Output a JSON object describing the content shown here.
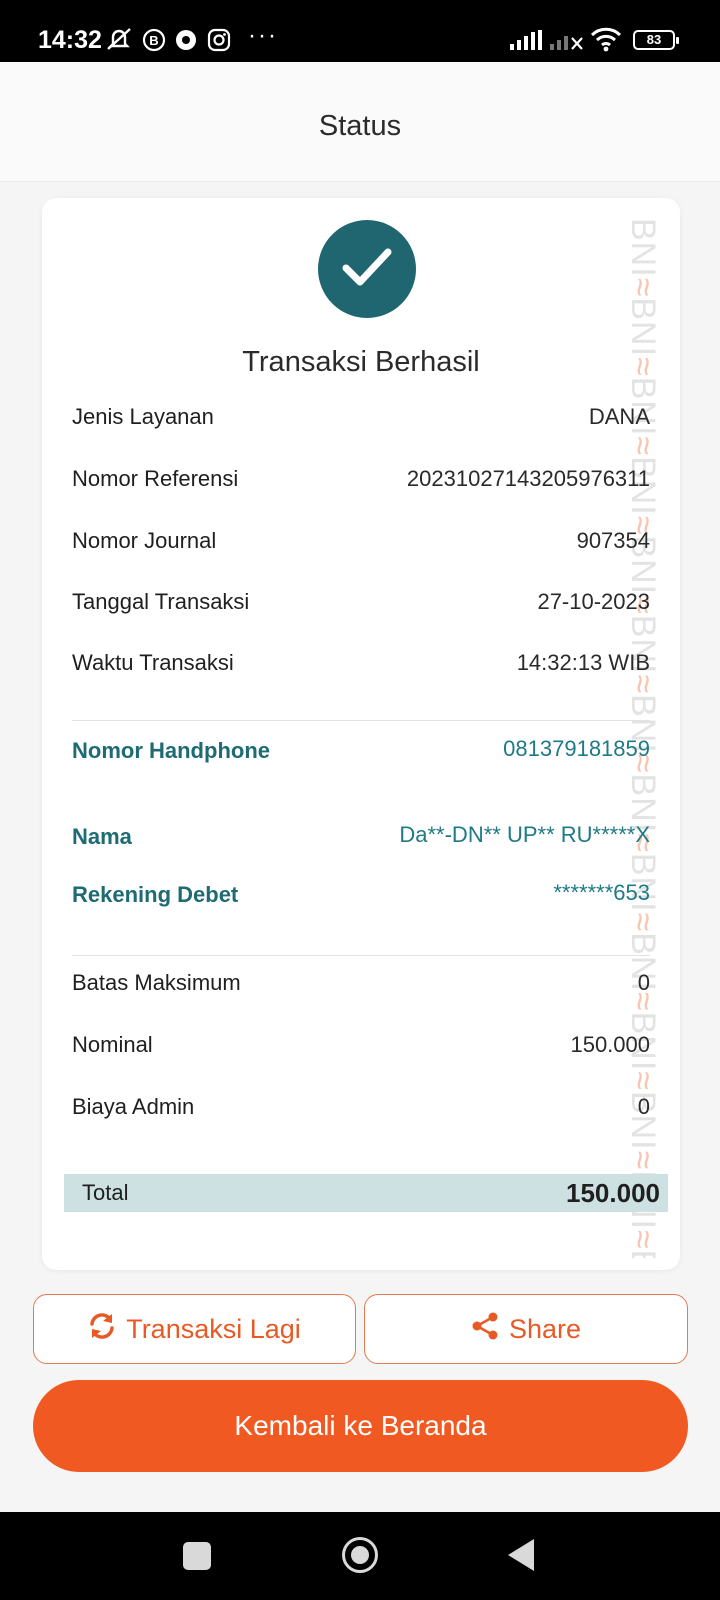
{
  "status_bar": {
    "time": "14:32",
    "battery": "83"
  },
  "header": {
    "title": "Status"
  },
  "watermark": {
    "brand": "BNI"
  },
  "receipt": {
    "title": "Transaksi Berhasil",
    "details": [
      {
        "label": "Jenis Layanan",
        "value": "DANA"
      },
      {
        "label": "Nomor Referensi",
        "value": "20231027143205976311"
      },
      {
        "label": "Nomor Journal",
        "value": "907354"
      },
      {
        "label": "Tanggal Transaksi",
        "value": "27-10-2023"
      },
      {
        "label": "Waktu Transaksi",
        "value": "14:32:13 WIB"
      }
    ],
    "account": [
      {
        "label": "Nomor Handphone",
        "value": "081379181859"
      },
      {
        "label": "Nama",
        "value": "Da**-DN** UP** RU*****X"
      },
      {
        "label": "Rekening Debet",
        "value": "*******653"
      }
    ],
    "amounts": [
      {
        "label": "Batas Maksimum",
        "value": "0"
      },
      {
        "label": "Nominal",
        "value": "150.000"
      },
      {
        "label": "Biaya Admin",
        "value": "0"
      }
    ],
    "total": {
      "label": "Total",
      "value": "150.000"
    }
  },
  "actions": {
    "repeat_label": "Transaksi Lagi",
    "share_label": "Share",
    "home_label": "Kembali ke Beranda"
  },
  "colors": {
    "accent": "#f05a22",
    "teal": "#1f6670",
    "total_bg": "#cde1e3"
  }
}
